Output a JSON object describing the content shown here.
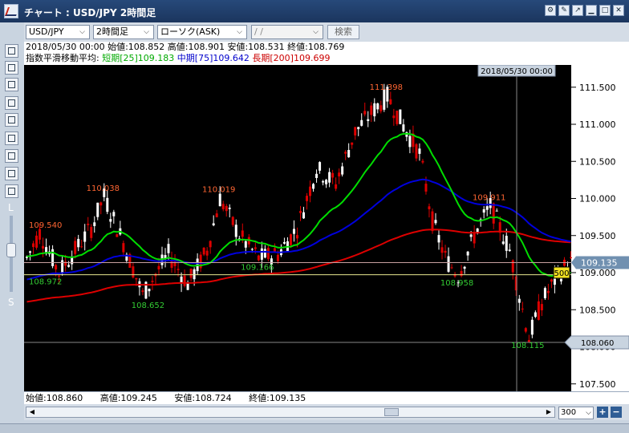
{
  "window": {
    "title": "チャート : USD/JPY 2時間足"
  },
  "toolbar": {
    "symbol": "USD/JPY",
    "timeframe": "2時間足",
    "chart_type": "ローソク(ASK)",
    "date": " /  / ",
    "search_label": "検索"
  },
  "info": {
    "ohlc_line": "2018/05/30 00:00 始値:108.852 高値:108.901 安値:108.531 終値:108.769",
    "ema_prefix": "指数平滑移動平均:",
    "ema_short": "短期[25]109.183",
    "ema_mid": "中期[75]109.642",
    "ema_long": "長期[200]109.699"
  },
  "leftbar": {
    "l_label": "L",
    "s_label": "S"
  },
  "chart": {
    "cursor_time": "2018/05/30 00:00",
    "current_price": "109.135",
    "crosshair_price": "108.060",
    "tag": "500",
    "colors": {
      "short": "#00dd00",
      "mid": "#0000dd",
      "long": "#dd0000",
      "up": "#ffffff",
      "down": "#dd0000"
    }
  },
  "chart_data": {
    "type": "candlestick",
    "y_ticks": [
      111.5,
      111.0,
      110.5,
      110.0,
      109.5,
      109.0,
      108.5,
      108.0,
      107.5
    ],
    "ylim": [
      107.4,
      111.8
    ],
    "annotations": [
      {
        "label": "111.398",
        "value": 111.398
      },
      {
        "label": "110.038",
        "value": 110.038
      },
      {
        "label": "110.019",
        "value": 110.019
      },
      {
        "label": "109.911",
        "value": 109.911
      },
      {
        "label": "109.540",
        "value": 109.54
      },
      {
        "label": "109.166",
        "value": 109.166
      },
      {
        "label": "108.972",
        "value": 108.972
      },
      {
        "label": "108.958",
        "value": 108.958
      },
      {
        "label": "108.652",
        "value": 108.652
      },
      {
        "label": "108.115",
        "value": 108.115
      }
    ]
  },
  "footer": {
    "open": "始値:108.860",
    "high": "高値:109.245",
    "low": "安値:108.724",
    "close": "終値:109.135"
  },
  "scroll": {
    "zoom_value": "300"
  }
}
